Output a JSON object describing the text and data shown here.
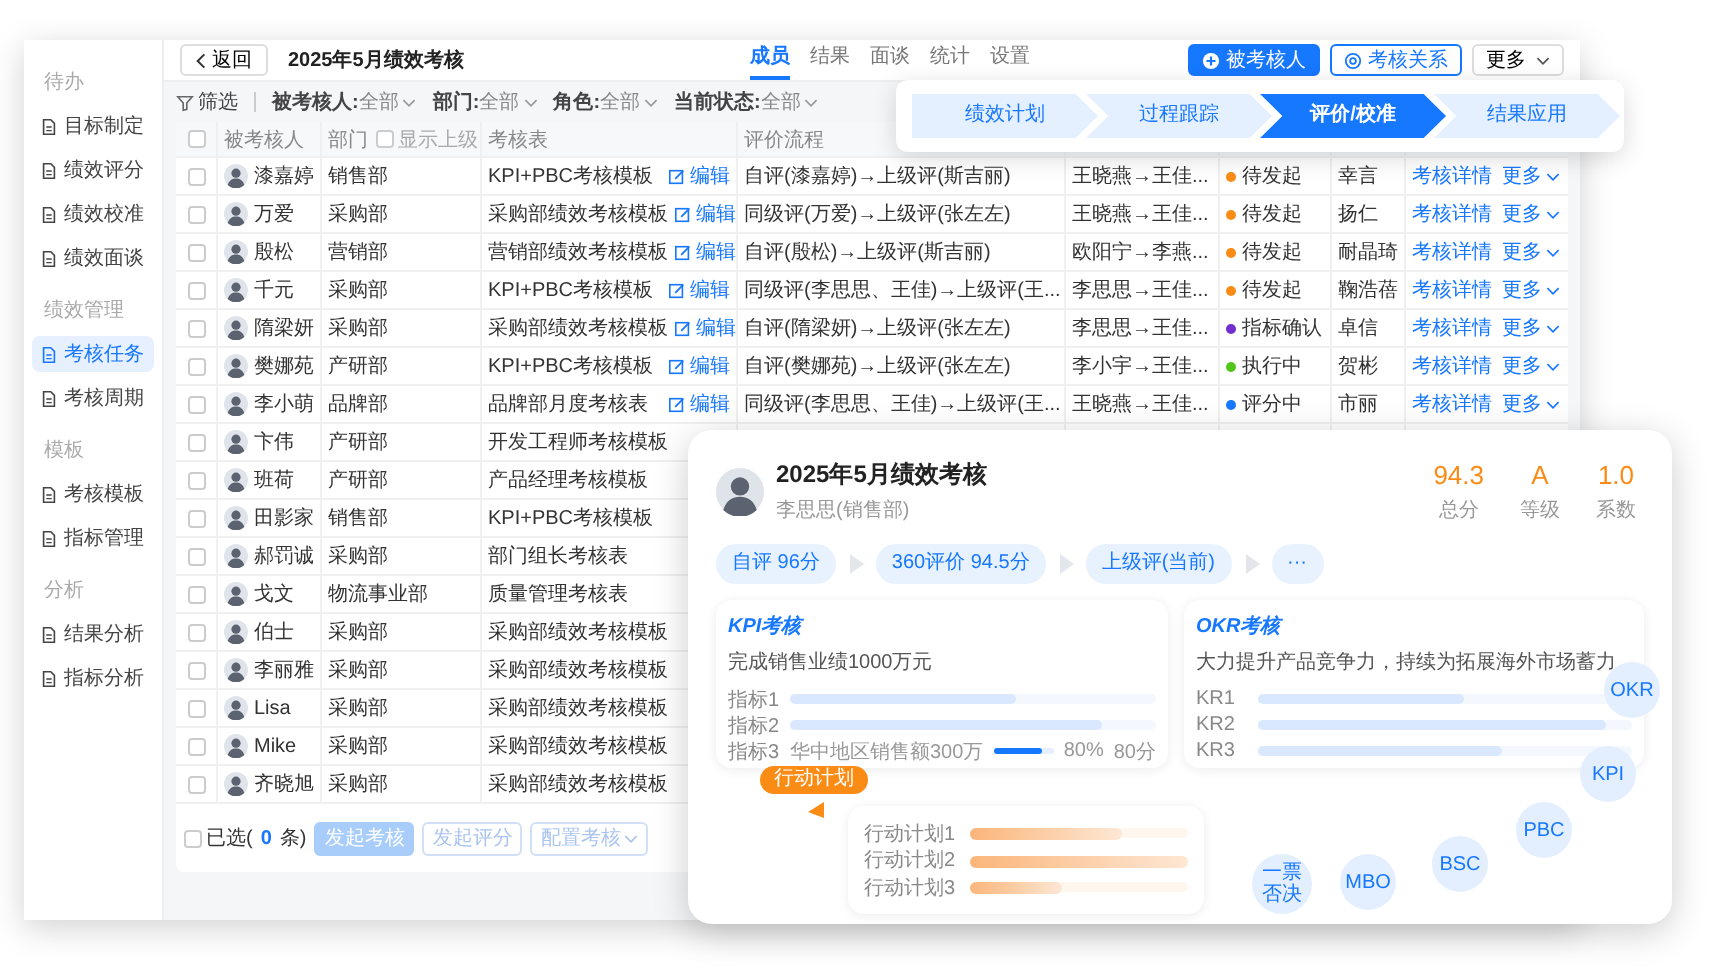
{
  "sidebar": {
    "groups": [
      {
        "title": "待办",
        "items": [
          {
            "label": "目标制定",
            "selected": false
          },
          {
            "label": "绩效评分",
            "selected": false
          },
          {
            "label": "绩效校准",
            "selected": false
          },
          {
            "label": "绩效面谈",
            "selected": false
          }
        ]
      },
      {
        "title": "绩效管理",
        "items": [
          {
            "label": "考核任务",
            "selected": true
          },
          {
            "label": "考核周期",
            "selected": false
          }
        ]
      },
      {
        "title": "模板",
        "items": [
          {
            "label": "考核模板",
            "selected": false
          },
          {
            "label": "指标管理",
            "selected": false
          }
        ]
      },
      {
        "title": "分析",
        "items": [
          {
            "label": "结果分析",
            "selected": false
          },
          {
            "label": "指标分析",
            "selected": false
          }
        ]
      }
    ]
  },
  "header": {
    "back": "返回",
    "title": "2025年5月绩效考核",
    "tabs": [
      {
        "label": "成员",
        "selected": true
      },
      {
        "label": "结果",
        "selected": false
      },
      {
        "label": "面谈",
        "selected": false
      },
      {
        "label": "统计",
        "selected": false
      },
      {
        "label": "设置",
        "selected": false
      }
    ],
    "actions": [
      {
        "label": "被考核人",
        "kind": "primary"
      },
      {
        "label": "考核关系",
        "kind": "outline"
      },
      {
        "label": "更多",
        "kind": "menu"
      }
    ]
  },
  "filters": {
    "label": "筛选",
    "items": [
      {
        "label": "被考核人:",
        "value": "全部"
      },
      {
        "label": "部门:",
        "value": "全部"
      },
      {
        "label": "角色:",
        "value": "全部"
      },
      {
        "label": "当前状态:",
        "value": "全部"
      }
    ]
  },
  "stepper": [
    {
      "label": "绩效计划",
      "selected": false
    },
    {
      "label": "过程跟踪",
      "selected": false
    },
    {
      "label": "评价/校准",
      "selected": true
    },
    {
      "label": "结果应用",
      "selected": false
    }
  ],
  "table": {
    "all_checked": false,
    "columns": [
      {
        "label": "被考核人"
      },
      {
        "label": "部门",
        "toggle": "显示上级",
        "toggle_checked": false
      },
      {
        "label": "考核表"
      },
      {
        "label": "评价流程"
      }
    ],
    "rows": [
      {
        "checked": false,
        "name": "漆嘉婷",
        "dept": "销售部",
        "template": "KPI+PBC考核模板",
        "edit": "编辑",
        "flow": "自评(漆嘉婷)→上级评(斯吉丽)",
        "reviewers": "王晓燕→王佳...",
        "status": "待发起",
        "color": "#fa8c16",
        "column_8": "幸言",
        "actions": [
          "考核详情",
          "更多"
        ]
      },
      {
        "checked": false,
        "name": "万爱",
        "dept": "采购部",
        "template": "采购部绩效考核模板",
        "edit": "编辑",
        "flow": "同级评(万爱)→上级评(张左左)",
        "reviewers": "王晓燕→王佳...",
        "status": "待发起",
        "color": "#fa8c16",
        "column_8": "扬仁",
        "actions": [
          "考核详情",
          "更多"
        ]
      },
      {
        "checked": false,
        "name": "殷松",
        "dept": "营销部",
        "template": "营销部绩效考核模板",
        "edit": "编辑",
        "flow": "自评(殷松)→上级评(斯吉丽)",
        "reviewers": "欧阳宁→李燕...",
        "status": "待发起",
        "color": "#fa8c16",
        "column_8": "耐晶琦",
        "actions": [
          "考核详情",
          "更多"
        ]
      },
      {
        "checked": false,
        "name": "千元",
        "dept": "采购部",
        "template": "KPI+PBC考核模板",
        "edit": "编辑",
        "flow": "同级评(李思思、王佳)→上级评(王...",
        "reviewers": "李思思→王佳...",
        "status": "待发起",
        "color": "#fa8c16",
        "column_8": "鞠浩蓓",
        "actions": [
          "考核详情",
          "更多"
        ]
      },
      {
        "checked": false,
        "name": "隋梁妍",
        "dept": "采购部",
        "template": "采购部绩效考核模板",
        "edit": "编辑",
        "flow": "自评(隋梁妍)→上级评(张左左)",
        "reviewers": "李思思→王佳...",
        "status": "指标确认",
        "color": "#722ed1",
        "column_8": "卓信",
        "actions": [
          "考核详情",
          "更多"
        ]
      },
      {
        "checked": false,
        "name": "樊娜苑",
        "dept": "产研部",
        "template": "KPI+PBC考核模板",
        "edit": "编辑",
        "flow": "自评(樊娜苑)→上级评(张左左)",
        "reviewers": "李小宇→王佳...",
        "status": "执行中",
        "color": "#52c41a",
        "column_8": "贺彬",
        "actions": [
          "考核详情",
          "更多"
        ]
      },
      {
        "checked": false,
        "name": "李小萌",
        "dept": "品牌部",
        "template": "品牌部月度考核表",
        "edit": "编辑",
        "flow": "同级评(李思思、王佳)→上级评(王...",
        "reviewers": "王晓燕→王佳...",
        "status": "评分中",
        "color": "#1677ff",
        "column_8": "市丽",
        "actions": [
          "考核详情",
          "更多"
        ]
      },
      {
        "checked": false,
        "name": "卞伟",
        "dept": "产研部",
        "template": "开发工程师考核模板"
      },
      {
        "checked": false,
        "name": "班荷",
        "dept": "产研部",
        "template": "产品经理考核模板"
      },
      {
        "checked": false,
        "name": "田影家",
        "dept": "销售部",
        "template": "KPI+PBC考核模板"
      },
      {
        "checked": false,
        "name": "郝罚诚",
        "dept": "采购部",
        "template": "部门组长考核表"
      },
      {
        "checked": false,
        "name": "戈文",
        "dept": "物流事业部",
        "template": "质量管理考核表"
      },
      {
        "checked": false,
        "name": "伯士",
        "dept": "采购部",
        "template": "采购部绩效考核模板"
      },
      {
        "checked": false,
        "name": "李丽雅",
        "dept": "采购部",
        "template": "采购部绩效考核模板"
      },
      {
        "checked": false,
        "name": "Lisa",
        "dept": "采购部",
        "template": "采购部绩效考核模板"
      },
      {
        "checked": false,
        "name": "Mike",
        "dept": "采购部",
        "template": "采购部绩效考核模板"
      },
      {
        "checked": false,
        "name": "齐晓旭",
        "dept": "采购部",
        "template": "采购部绩效考核模板"
      }
    ]
  },
  "footer": {
    "checked": false,
    "selected_prefix": "已选(",
    "count": "0",
    "selected_suffix": "条)",
    "buttons": [
      {
        "label": "发起考核",
        "kind": "primary"
      },
      {
        "label": "发起评分",
        "kind": "plain"
      },
      {
        "label": "配置考核",
        "kind": "menu"
      }
    ]
  },
  "card": {
    "title": "2025年5月绩效考核",
    "subtitle": "李思思(销售部)",
    "stats": [
      {
        "value": "94.3",
        "label": "总分"
      },
      {
        "value": "A",
        "label": "等级"
      },
      {
        "value": "1.0",
        "label": "系数"
      }
    ],
    "flow": [
      "自评 96分",
      "360评价 94.5分",
      "上级评(当前)",
      "···"
    ],
    "kpi": {
      "heading": "KPI考核",
      "goal": "完成销售业绩1000万元",
      "items": [
        {
          "label": "指标1",
          "level": 0.62
        },
        {
          "label": "指标2",
          "level": 0.85
        },
        {
          "label": "指标3",
          "detail": "华中地区销售额300万",
          "level": 0.8,
          "percent": "80%",
          "score": "80分"
        }
      ]
    },
    "okr": {
      "heading": "OKR考核",
      "goal": "大力提升产品竞争力，持续为拓展海外市场蓄力",
      "items": [
        {
          "label": "KR1",
          "level": 0.55
        },
        {
          "label": "KR2",
          "level": 0.93
        },
        {
          "label": "KR3",
          "level": 0.65
        }
      ]
    },
    "tag": "行动计划",
    "plans": [
      {
        "label": "行动计划1",
        "level": 0.7
      },
      {
        "label": "行动计划2",
        "level": 1.0
      },
      {
        "label": "行动计划3",
        "level": 0.42
      }
    ],
    "methods": [
      "OKR",
      "KPI",
      "PBC",
      "BSC",
      "MBO",
      "一票否决"
    ]
  }
}
